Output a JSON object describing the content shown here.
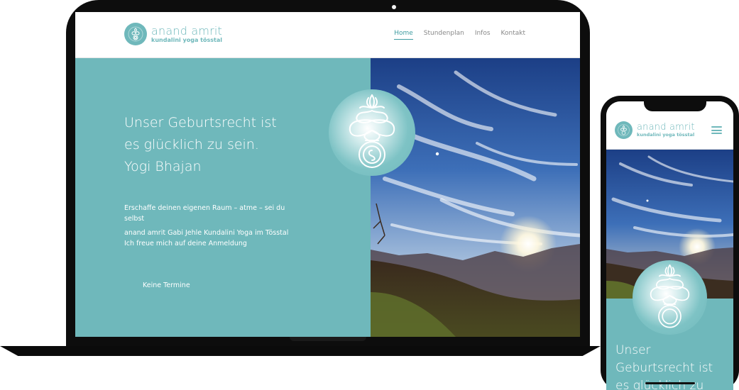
{
  "site": {
    "logo_name": "anand amrit",
    "logo_sub": "kundalini yoga tösstal"
  },
  "nav": [
    {
      "label": "Home",
      "active": true
    },
    {
      "label": "Stundenplan",
      "active": false
    },
    {
      "label": "Infos",
      "active": false
    },
    {
      "label": "Kontakt",
      "active": false
    }
  ],
  "hero": {
    "quote_lines": [
      "Unser Geburtsrecht ist",
      "es glücklich zu sein.",
      "Yogi Bhajan"
    ],
    "intro_lines": [
      "Erschaffe deinen eigenen Raum – atme – sei du",
      "selbst"
    ],
    "sub_lines": [
      "anand amrit Gabi Jehle Kundalini Yoga im Tösstal",
      "Ich freue mich auf deine Anmeldung"
    ],
    "events": "Keine Termine"
  },
  "phone": {
    "quote_lines": [
      "Unser",
      "Geburtsrecht ist",
      "es glücklich zu"
    ]
  },
  "colors": {
    "teal": "#6fb8bb",
    "accent": "#3f9ca1",
    "device": "#0d0d0d"
  },
  "icons": {
    "logo": "yantra-emblem-icon",
    "menu": "hamburger-menu-icon"
  }
}
